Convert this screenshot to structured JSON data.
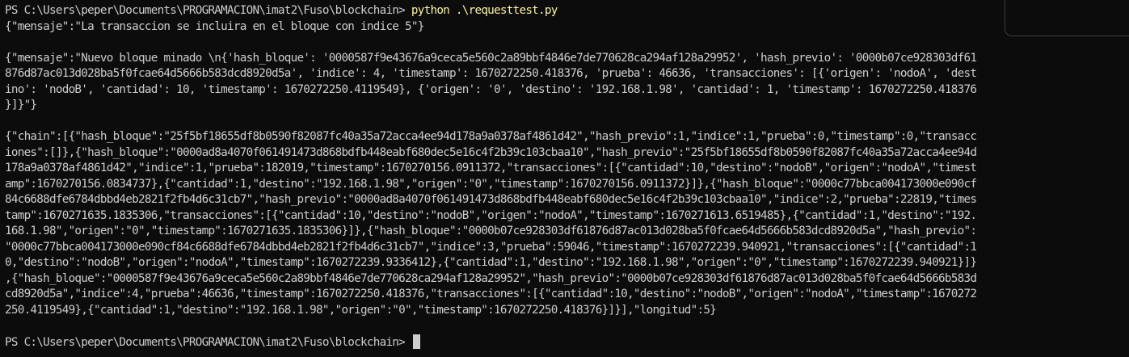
{
  "terminal": {
    "prompt": "PS C:\\Users\\peper\\Documents\\PROGRAMACION\\imat2\\Fuso\\blockchain> ",
    "command": "python .\\requesttest.py",
    "output": [
      "{\"mensaje\":\"La transaccion se incluira en el bloque con indice 5\"}",
      "",
      "{\"mensaje\":\"Nuevo bloque minado \\n{'hash_bloque': '0000587f9e43676a9ceca5e560c2a89bbf4846e7de770628ca294af128a29952', 'hash_previo': '0000b07ce928303df61",
      "876d87ac013d028ba5f0fcae64d5666b583dcd8920d5a', 'indice': 4, 'timestamp': 1670272250.418376, 'prueba': 46636, 'transacciones': [{'origen': 'nodoA', 'dest",
      "ino': 'nodoB', 'cantidad': 10, 'timestamp': 1670272250.4119549}, {'origen': '0', 'destino': '192.168.1.98', 'cantidad': 1, 'timestamp': 1670272250.418376",
      "}]}\"}",
      "",
      "{\"chain\":[{\"hash_bloque\":\"25f5bf18655df8b0590f82087fc40a35a72acca4ee94d178a9a0378af4861d42\",\"hash_previo\":1,\"indice\":1,\"prueba\":0,\"timestamp\":0,\"transacc",
      "iones\":[]},{\"hash_bloque\":\"0000ad8a4070f061491473d868bdfb448eabf680dec5e16c4f2b39c103cbaa10\",\"hash_previo\":\"25f5bf18655df8b0590f82087fc40a35a72acca4ee94d",
      "178a9a0378af4861d42\",\"indice\":1,\"prueba\":182019,\"timestamp\":1670270156.0911372,\"transacciones\":[{\"cantidad\":10,\"destino\":\"nodoB\",\"origen\":\"nodoA\",\"timest",
      "amp\":1670270156.0834737},{\"cantidad\":1,\"destino\":\"192.168.1.98\",\"origen\":\"0\",\"timestamp\":1670270156.0911372}]},{\"hash_bloque\":\"0000c77bbca004173000e090cf",
      "84c6688dfe6784dbbd4eb2821f2fb4d6c31cb7\",\"hash_previo\":\"0000ad8a4070f061491473d868bdfb448eabf680dec5e16c4f2b39c103cbaa10\",\"indice\":2,\"prueba\":22819,\"times",
      "tamp\":1670271635.1835306,\"transacciones\":[{\"cantidad\":10,\"destino\":\"nodoB\",\"origen\":\"nodoA\",\"timestamp\":1670271613.6519485},{\"cantidad\":1,\"destino\":\"192.",
      "168.1.98\",\"origen\":\"0\",\"timestamp\":1670271635.1835306}]},{\"hash_bloque\":\"0000b07ce928303df61876d87ac013d028ba5f0fcae64d5666b583dcd8920d5a\",\"hash_previo\":",
      "\"0000c77bbca004173000e090cf84c6688dfe6784dbbd4eb2821f2fb4d6c31cb7\",\"indice\":3,\"prueba\":59046,\"timestamp\":1670272239.940921,\"transacciones\":[{\"cantidad\":1",
      "0,\"destino\":\"nodoB\",\"origen\":\"nodoA\",\"timestamp\":1670272239.9336412},{\"cantidad\":1,\"destino\":\"192.168.1.98\",\"origen\":\"0\",\"timestamp\":1670272239.940921}]}",
      ",{\"hash_bloque\":\"0000587f9e43676a9ceca5e560c2a89bbf4846e7de770628ca294af128a29952\",\"hash_previo\":\"0000b07ce928303df61876d87ac013d028ba5f0fcae64d5666b583d",
      "cd8920d5a\",\"indice\":4,\"prueba\":46636,\"timestamp\":1670272250.418376,\"transacciones\":[{\"cantidad\":10,\"destino\":\"nodoB\",\"origen\":\"nodoA\",\"timestamp\":1670272",
      "250.4119549},{\"cantidad\":1,\"destino\":\"192.168.1.98\",\"origen\":\"0\",\"timestamp\":1670272250.418376}]}],\"longitud\":5}",
      ""
    ],
    "final_prompt": "PS C:\\Users\\peper\\Documents\\PROGRAMACION\\imat2\\Fuso\\blockchain> "
  },
  "colors": {
    "background": "#0c0c0c",
    "text": "#cccccc",
    "command": "#f9f1a5"
  }
}
